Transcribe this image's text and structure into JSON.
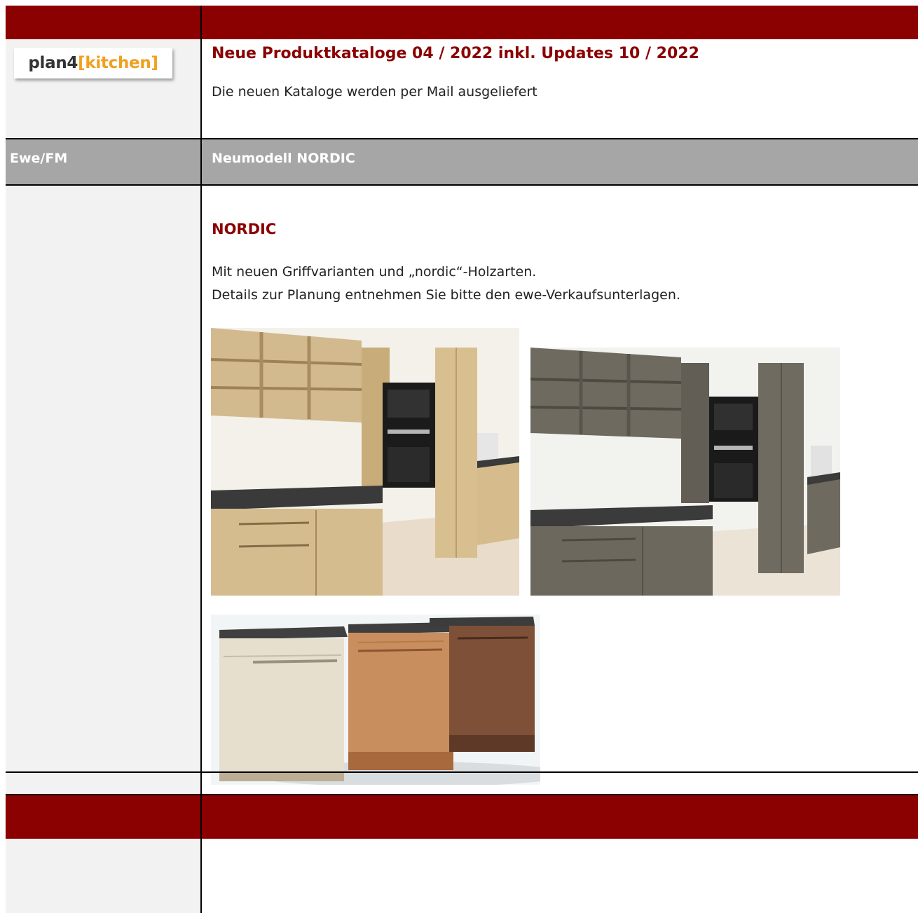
{
  "logo": {
    "prefix": "plan4",
    "bracket_open": "[",
    "word": "kitchen",
    "bracket_close": "]"
  },
  "intro": {
    "title": "Neue Produktkataloge 04 / 2022  inkl. Updates 10 / 2022",
    "text": "Die neuen Kataloge werden per Mail ausgeliefert"
  },
  "section": {
    "left_label": "Ewe/FM",
    "right_label": "Neumodell NORDIC"
  },
  "content": {
    "heading": "NORDIC",
    "line1": "Mit neuen Griffvarianten und „nordic“-Holzarten.",
    "line2": "Details zur Planung entnehmen Sie bitte den ewe-Verkaufsunterlagen."
  },
  "colors": {
    "band": "#8b0000",
    "grey_row": "#a6a6a6",
    "left_cell": "#f2f2f2",
    "heading": "#8b0000",
    "logo_accent": "#f0a020"
  }
}
